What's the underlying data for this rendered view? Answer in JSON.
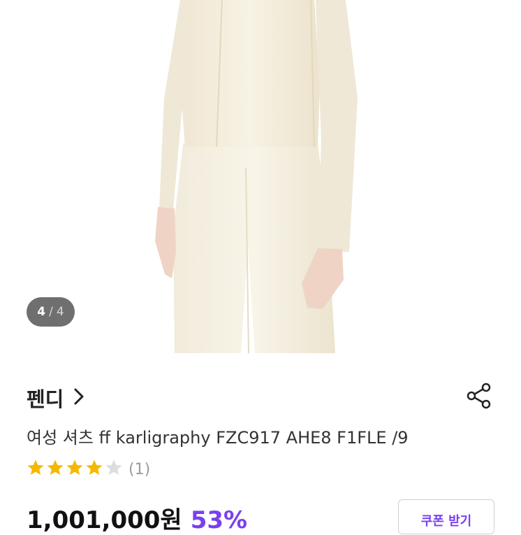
{
  "gallery": {
    "current": "4",
    "separator": "/",
    "total": "4"
  },
  "product": {
    "brand": "펜디",
    "title": "여성 셔츠 ff karligraphy FZC917 AHE8 F1FLE /9",
    "rating": 4,
    "rating_max": 5,
    "review_count": "(1)",
    "price": "1,001,000원",
    "discount": "53%"
  },
  "actions": {
    "coupon_label": "쿠폰 받기"
  },
  "icons": {
    "brand_chevron": "chevron-right-icon",
    "share": "share-icon",
    "star_filled": "star-filled-icon",
    "star_empty": "star-empty-icon"
  },
  "colors": {
    "accent": "#7a3ff0",
    "star": "#f5b800",
    "star_empty": "#dddddd"
  }
}
